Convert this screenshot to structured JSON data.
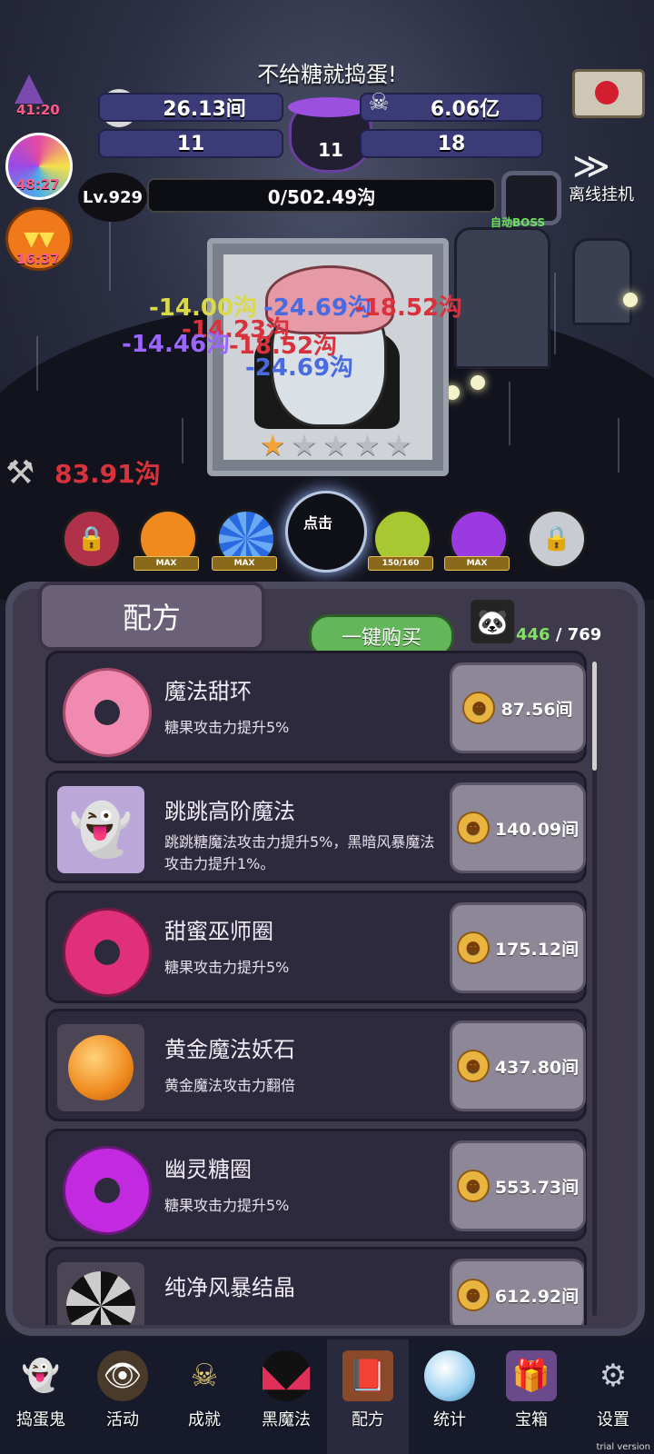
{
  "header": {
    "title": "不给糖就捣蛋!",
    "stats": {
      "candy_rate": "26.13间",
      "souls": "6.06亿",
      "bats": "11",
      "cauldron": "11",
      "candy_corn": "18"
    },
    "left_badges": [
      "41:20",
      "48:27",
      "16:37"
    ],
    "level": "Lv.929",
    "xp": "0/502.49沟",
    "boss_label": "自动BOSS",
    "offline_label": "离线挂机"
  },
  "battle": {
    "damage_numbers": [
      {
        "text": "-14.00沟",
        "color": "#d9d94a"
      },
      {
        "text": "-24.69沟",
        "color": "#4a6ae0"
      },
      {
        "text": "-18.52沟",
        "color": "#d8323c"
      },
      {
        "text": "-14.23沟",
        "color": "#d8323c"
      },
      {
        "text": "-14.46沟",
        "color": "#9a66ff"
      },
      {
        "text": "-18.52沟",
        "color": "#d8323c"
      },
      {
        "text": "-24.69沟",
        "color": "#4a6ae0"
      }
    ],
    "axe_damage": "83.91沟",
    "stars_filled": 1,
    "stars_total": 5,
    "tap_label": "点击",
    "skills": [
      {
        "icon": "locked-red-candy-icon",
        "tag": ""
      },
      {
        "icon": "orange-ghost-candy-icon",
        "tag": "MAX"
      },
      {
        "icon": "blue-swirl-candy-icon",
        "tag": "MAX"
      },
      {
        "icon": "bat-demon-icon",
        "tag": ""
      },
      {
        "icon": "green-slime-candy-icon",
        "tag": "150/160"
      },
      {
        "icon": "purple-skull-candy-icon",
        "tag": "MAX"
      },
      {
        "icon": "locked-gray-candy-icon",
        "tag": ""
      }
    ]
  },
  "recipes_panel": {
    "title": "配方",
    "buy_all_label": "一键购买",
    "count_current": "446",
    "count_total": "769",
    "items": [
      {
        "name": "魔法甜环",
        "desc": "糖果攻击力提升5%",
        "price": "87.56间",
        "icon": "pink-donut-icon"
      },
      {
        "name": "跳跳高阶魔法",
        "desc": "跳跳糖魔法攻击力提升5%，黑暗风暴魔法攻击力提升1%。",
        "price": "140.09间",
        "icon": "ghost-mask-icon"
      },
      {
        "name": "甜蜜巫师圈",
        "desc": "糖果攻击力提升5%",
        "price": "175.12间",
        "icon": "magenta-donut-icon"
      },
      {
        "name": "黄金魔法妖石",
        "desc": "黄金魔法攻击力翻倍",
        "price": "437.80间",
        "icon": "orange-candy-icon"
      },
      {
        "name": "幽灵糖圈",
        "desc": "糖果攻击力提升5%",
        "price": "553.73间",
        "icon": "purple-donut-icon"
      },
      {
        "name": "纯净风暴结晶",
        "desc": "",
        "price": "612.92间",
        "icon": "swirl-crystal-icon"
      }
    ]
  },
  "nav": {
    "items": [
      {
        "label": "捣蛋鬼",
        "icon": "ghost-icon"
      },
      {
        "label": "活动",
        "icon": "eyeball-cake-icon"
      },
      {
        "label": "成就",
        "icon": "skull-trophy-icon"
      },
      {
        "label": "黑魔法",
        "icon": "demon-icon"
      },
      {
        "label": "配方",
        "icon": "recipe-book-icon"
      },
      {
        "label": "统计",
        "icon": "crystal-ball-icon"
      },
      {
        "label": "宝箱",
        "icon": "gift-box-icon"
      },
      {
        "label": "设置",
        "icon": "gear-icon"
      }
    ]
  },
  "watermark": "trial version"
}
